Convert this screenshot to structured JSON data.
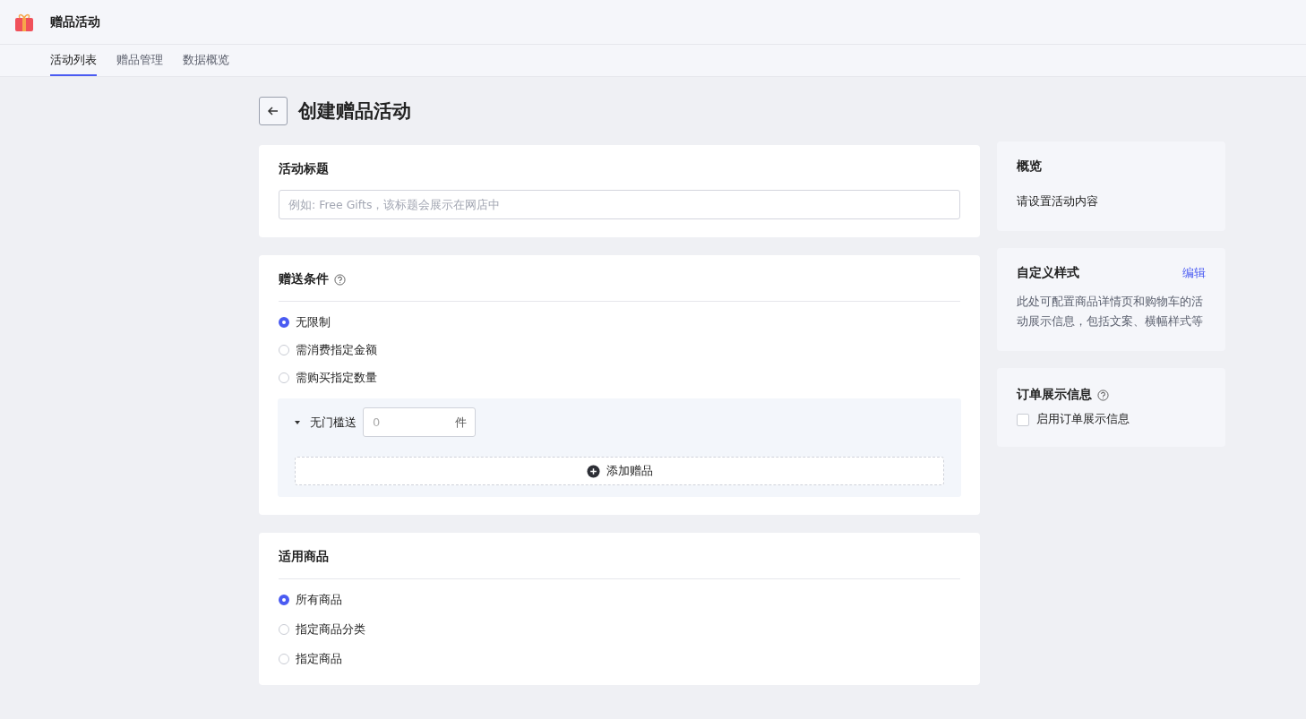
{
  "app": {
    "title": "赠品活动"
  },
  "tabs": [
    {
      "label": "活动列表",
      "selected": true
    },
    {
      "label": "赠品管理",
      "selected": false
    },
    {
      "label": "数据概览",
      "selected": false
    }
  ],
  "page": {
    "title": "创建赠品活动"
  },
  "title_card": {
    "heading": "活动标题",
    "placeholder": "例如: Free Gifts，该标题会展示在网店中"
  },
  "condition_card": {
    "heading": "赠送条件",
    "options": [
      {
        "label": "无限制",
        "selected": true
      },
      {
        "label": "需消费指定金额",
        "selected": false
      },
      {
        "label": "需购买指定数量",
        "selected": false
      }
    ],
    "tier": {
      "label": "无门槛送",
      "placeholder": "0",
      "unit": "件",
      "expanded": true
    },
    "add_button": "添加赠品"
  },
  "products_card": {
    "heading": "适用商品",
    "options": [
      {
        "label": "所有商品",
        "selected": true
      },
      {
        "label": "指定商品分类",
        "selected": false
      },
      {
        "label": "指定商品",
        "selected": false
      }
    ]
  },
  "overview": {
    "heading": "概览",
    "text": "请设置活动内容"
  },
  "custom_style": {
    "heading": "自定义样式",
    "link": "编辑",
    "text": "此处可配置商品详情页和购物车的活动展示信息，包括文案、横幅样式等"
  },
  "order_info": {
    "heading": "订单展示信息",
    "checkbox": {
      "label": "启用订单展示信息",
      "checked": false
    }
  }
}
